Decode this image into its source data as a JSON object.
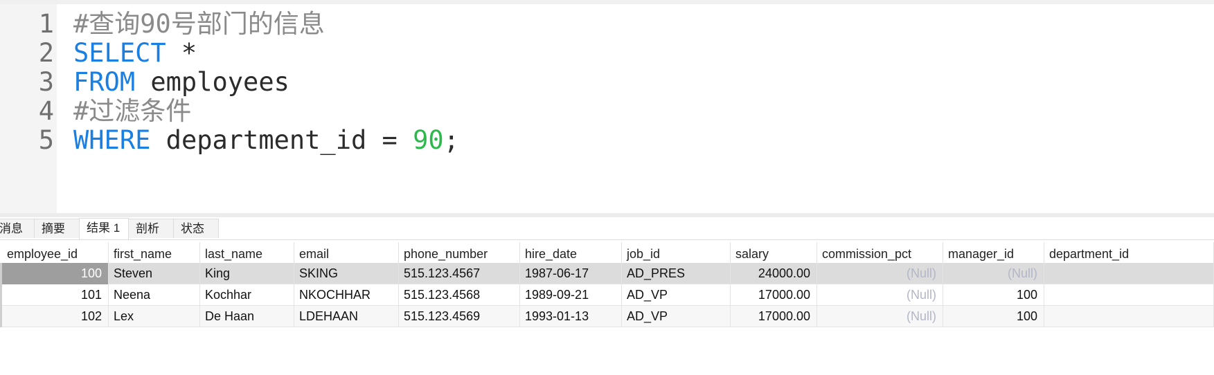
{
  "editor": {
    "lines": [
      {
        "num": "1",
        "tokens": [
          {
            "t": "#查询90号部门的信息",
            "k": "comment"
          }
        ]
      },
      {
        "num": "2",
        "tokens": [
          {
            "t": "SELECT",
            "k": "kw"
          },
          {
            "t": " *",
            "k": "plain"
          }
        ]
      },
      {
        "num": "3",
        "tokens": [
          {
            "t": "FROM",
            "k": "kw"
          },
          {
            "t": " employees",
            "k": "plain"
          }
        ]
      },
      {
        "num": "4",
        "tokens": [
          {
            "t": "#过滤条件",
            "k": "comment"
          }
        ]
      },
      {
        "num": "5",
        "tokens": [
          {
            "t": "WHERE",
            "k": "kw"
          },
          {
            "t": " department_id = ",
            "k": "plain"
          },
          {
            "t": "90",
            "k": "num"
          },
          {
            "t": ";",
            "k": "plain"
          }
        ]
      }
    ]
  },
  "tabs": [
    {
      "label": "消息",
      "active": false
    },
    {
      "label": "摘要",
      "active": false
    },
    {
      "label": "结果 1",
      "active": true
    },
    {
      "label": "剖析",
      "active": false
    },
    {
      "label": "状态",
      "active": false
    }
  ],
  "grid": {
    "columns": [
      "employee_id",
      "first_name",
      "last_name",
      "email",
      "phone_number",
      "hire_date",
      "job_id",
      "salary",
      "commission_pct",
      "manager_id",
      "department_id"
    ],
    "rows": [
      [
        "100",
        "Steven",
        "King",
        "SKING",
        "515.123.4567",
        "1987-06-17",
        "AD_PRES",
        "24000.00",
        "(Null)",
        "(Null)",
        ""
      ],
      [
        "101",
        "Neena",
        "Kochhar",
        "NKOCHHAR",
        "515.123.4568",
        "1989-09-21",
        "AD_VP",
        "17000.00",
        "(Null)",
        "100",
        ""
      ],
      [
        "102",
        "Lex",
        "De Haan",
        "LDEHAAN",
        "515.123.4569",
        "1993-01-13",
        "AD_VP",
        "17000.00",
        "(Null)",
        "100",
        ""
      ]
    ]
  },
  "colors": {
    "keyword": "#1a7fe3",
    "comment": "#8a8a8a",
    "number": "#2cb84a",
    "null_text": "#b2b6c8",
    "selected_row": "#dcdcdc"
  }
}
